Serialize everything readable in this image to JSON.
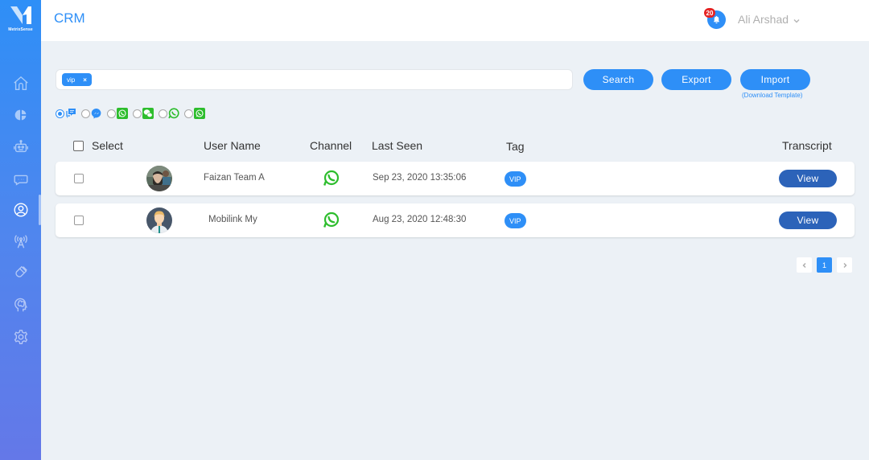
{
  "brand": {
    "name": "MetrixSense"
  },
  "header": {
    "title": "CRM",
    "notifications_count": "20",
    "user_name": "Ali Arshad"
  },
  "sidebar": {
    "items": [
      {
        "icon": "home-icon",
        "label": "Home"
      },
      {
        "icon": "pie-chart-icon",
        "label": "Analytics"
      },
      {
        "icon": "robot-icon",
        "label": "Bots"
      },
      {
        "icon": "chat-icon",
        "label": "Conversations"
      },
      {
        "icon": "user-circle-icon",
        "label": "CRM",
        "active": true
      },
      {
        "icon": "broadcast-tower-icon",
        "label": "Broadcast"
      },
      {
        "icon": "magnet-icon",
        "label": "Leads"
      },
      {
        "icon": "brain-head-icon",
        "label": "Training"
      },
      {
        "icon": "gear-icon",
        "label": "Settings"
      }
    ]
  },
  "search": {
    "chips": [
      {
        "label": "vip",
        "remove": "×"
      }
    ],
    "placeholder": "",
    "search_label": "Search",
    "export_label": "Export",
    "import_label": "Import",
    "download_template_label": "(Download Template)"
  },
  "channel_filter": {
    "selected": "web-chat",
    "options": [
      {
        "id": "web-chat",
        "icon": "web-chat-icon",
        "color": "#2e8ff7"
      },
      {
        "id": "messenger",
        "icon": "messenger-icon",
        "color": "#2e8ff7"
      },
      {
        "id": "whatsapp-business",
        "icon": "whatsapp-square-icon",
        "color": "#2dbd2d"
      },
      {
        "id": "wechat",
        "icon": "wechat-icon",
        "color": "#2dbd2d"
      },
      {
        "id": "whatsapp",
        "icon": "whatsapp-icon",
        "color": "#2dbd2d"
      },
      {
        "id": "whatsapp-2",
        "icon": "whatsapp-square-icon",
        "color": "#2dbd2d"
      }
    ]
  },
  "table": {
    "columns": {
      "select": "Select",
      "user_name": "User Name",
      "channel": "Channel",
      "last_seen": "Last Seen",
      "tag": "Tag",
      "transcript": "Transcript"
    },
    "rows": [
      {
        "user_name": "Faizan Team A",
        "channel": "whatsapp",
        "last_seen": "Sep 23, 2020 13:35:06",
        "tag": "VIP",
        "action": "View",
        "avatar": "photo"
      },
      {
        "user_name": "Mobilink My",
        "channel": "whatsapp",
        "last_seen": "Aug 23, 2020 12:48:30",
        "tag": "VIP",
        "action": "View",
        "avatar": "default"
      }
    ]
  },
  "pagination": {
    "current_page": "1",
    "prev": "‹",
    "next": "›"
  },
  "colors": {
    "primary": "#2e8ff7",
    "view_button": "#2c63b9",
    "whatsapp": "#2dbd2d",
    "badge": "#e52323"
  }
}
